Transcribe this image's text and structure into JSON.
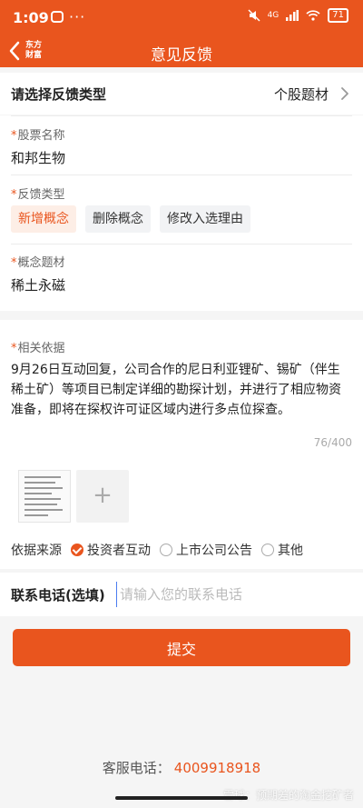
{
  "status_bar": {
    "time": "1:09",
    "dots": "···",
    "network": "4G",
    "battery": "71",
    "icons": [
      "message-icon",
      "mute-icon",
      "signal-icon",
      "wifi-icon",
      "battery-icon"
    ]
  },
  "nav": {
    "logo_line1": "东方",
    "logo_line2": "财富",
    "title": "意见反馈",
    "back_icon": "chevron-left-icon"
  },
  "feedback_type": {
    "label": "请选择反馈类型",
    "value": "个股题材",
    "icon": "chevron-right-icon"
  },
  "stock": {
    "required_mark": "*",
    "label": "股票名称",
    "value": "和邦生物"
  },
  "feedback_kind": {
    "required_mark": "*",
    "label": "反馈类型",
    "options": [
      "新增概念",
      "删除概念",
      "修改入选理由"
    ],
    "selected": "新增概念"
  },
  "concept": {
    "required_mark": "*",
    "label": "概念题材",
    "value": "稀土永磁"
  },
  "basis": {
    "required_mark": "*",
    "label": "相关依据",
    "text": "9月26日互动回复，公司合作的尼日利亚锂矿、锡矿（伴生稀土矿）等项目已制定详细的勘探计划，并进行了相应物资准备，即将在探权许可证区域内进行多点位探查。",
    "counter": "76/400",
    "add_symbol": "+"
  },
  "source": {
    "label": "依据来源",
    "options": [
      "投资者互动",
      "上市公司公告",
      "其他"
    ],
    "selected": "投资者互动"
  },
  "phone": {
    "label": "联系电话(选填)",
    "placeholder": "请输入您的联系电话",
    "value": ""
  },
  "submit_label": "提交",
  "service": {
    "label": "客服电话：",
    "number": "4009918918"
  },
  "watermark": "雪球：预期差的淘金挖矿者",
  "colors": {
    "brand": "#e9551e",
    "chip_active_bg": "#fdeee6",
    "page_bg": "#f5f5f5"
  }
}
